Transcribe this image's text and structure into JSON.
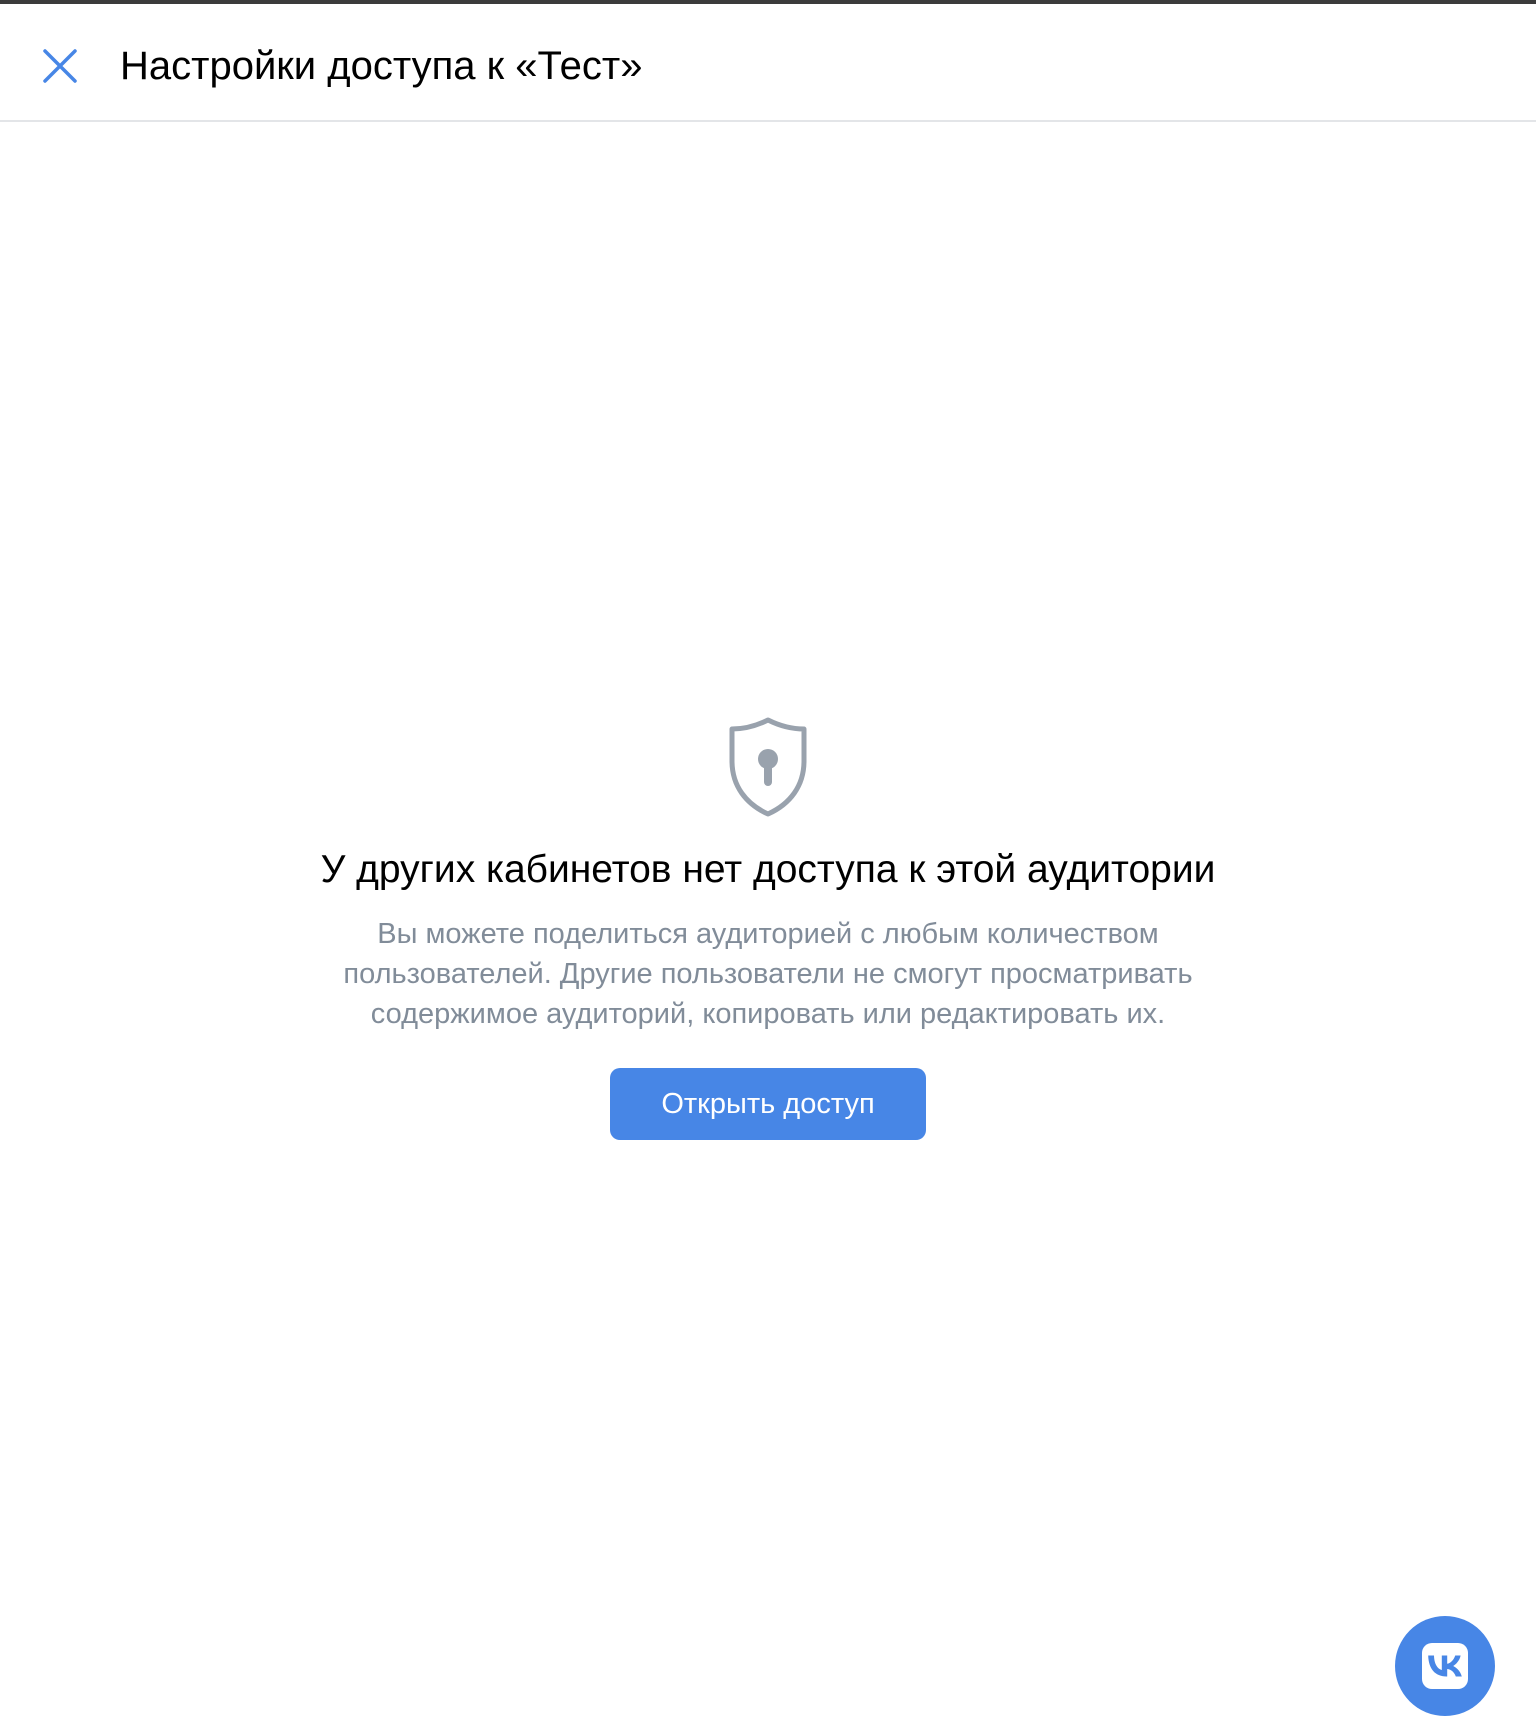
{
  "header": {
    "title": "Настройки доступа к «Тест»",
    "close_icon": "close-icon"
  },
  "empty_state": {
    "icon": "shield-keyhole-icon",
    "title": "У других кабинетов нет доступа к этой аудитории",
    "text": "Вы можете поделиться аудиторией с любым количеством пользователей. Другие пользователи не смогут просматривать содержимое аудиторий, копировать или редактировать их.",
    "button_label": "Открыть доступ"
  },
  "floating": {
    "icon": "vk-logo-icon"
  },
  "colors": {
    "accent": "#4786e6",
    "secondary_text": "#818c99",
    "divider": "#e3e5e8"
  }
}
